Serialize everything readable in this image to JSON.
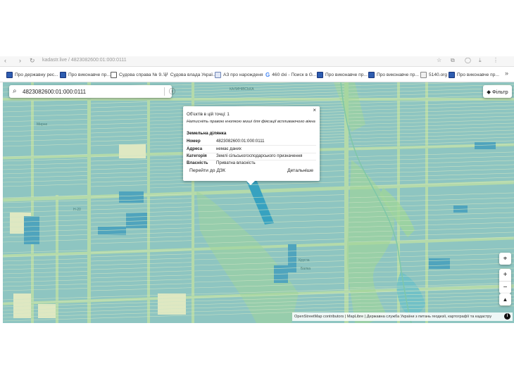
{
  "browser": {
    "address": "kadastr.live / 4823082600:01:000:0111"
  },
  "bookmarks": [
    {
      "label": "Про державну рес...",
      "icon": "gov-icon"
    },
    {
      "label": "Про виконавче пр...",
      "icon": "gov-icon"
    },
    {
      "label": "Судова справа № 9...",
      "icon": "court-icon"
    },
    {
      "label": "Судова влада Украї...",
      "icon": "trident-icon"
    },
    {
      "label": "АЗ про нарожденя",
      "icon": "az-icon"
    },
    {
      "label": "460 dxi - Поиск в G...",
      "icon": "google-icon"
    },
    {
      "label": "Про виконавче пр...",
      "icon": "gov-icon"
    },
    {
      "label": "Про виконавче пр...",
      "icon": "gov-icon"
    },
    {
      "label": "5140.org",
      "icon": "doc-icon"
    },
    {
      "label": "Про виконавче пр...",
      "icon": "gov-icon"
    }
  ],
  "bookmarks_more": "»",
  "search": {
    "value": "4823082600:01:000:0111",
    "placeholder": ""
  },
  "filter_button": {
    "label": "Фільтр"
  },
  "popup": {
    "count_text": "Об'єктів в цій точці: 1",
    "hint_text": "Натисніть правою кнопкою миші для фіксації вспливаючого вікна",
    "section_title": "Земельна ділянка",
    "rows": [
      {
        "key": "Номер",
        "value": "4823082600:01:000:0111"
      },
      {
        "key": "Адреса",
        "value": "немає даних"
      },
      {
        "key": "Категорія",
        "value": "Землі сільськогосподарського призначення"
      },
      {
        "key": "Власність",
        "value": "Приватна власність"
      }
    ],
    "goto_label": "Перейти до ДЗК",
    "details_label": "Детальніше",
    "close_label": "×"
  },
  "map_controls": {
    "locate": "⌖",
    "zoom_in": "+",
    "zoom_out": "−",
    "compass": "▲"
  },
  "attribution": "OpenStreetMap contributors | MapLibre | Державна служба України з питань геодезії, картографії та кадастру",
  "colors": {
    "parcel_fill": "#8ec5c1",
    "parcel_border": "#d8e9b9",
    "field_green": "#b7dca9",
    "highlight": "#37a2c0"
  }
}
